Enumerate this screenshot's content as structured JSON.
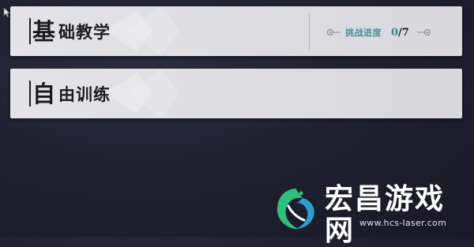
{
  "menu": {
    "basic_tutorial": {
      "title_first": "基",
      "title_rest": "础教学",
      "progress_label": "挑战进度",
      "progress_done": "0",
      "progress_total": "/7"
    },
    "free_training": {
      "title_first": "自",
      "title_rest": "由训练"
    }
  },
  "watermark": {
    "logo": "dragon-logo",
    "title": "宏昌游戏网",
    "url": "www.hcs-laser.com"
  },
  "colors": {
    "panel": "#e2e1e6",
    "accent": "#3d8794",
    "background": "#20212f",
    "watermark_green": "#32c07a"
  }
}
